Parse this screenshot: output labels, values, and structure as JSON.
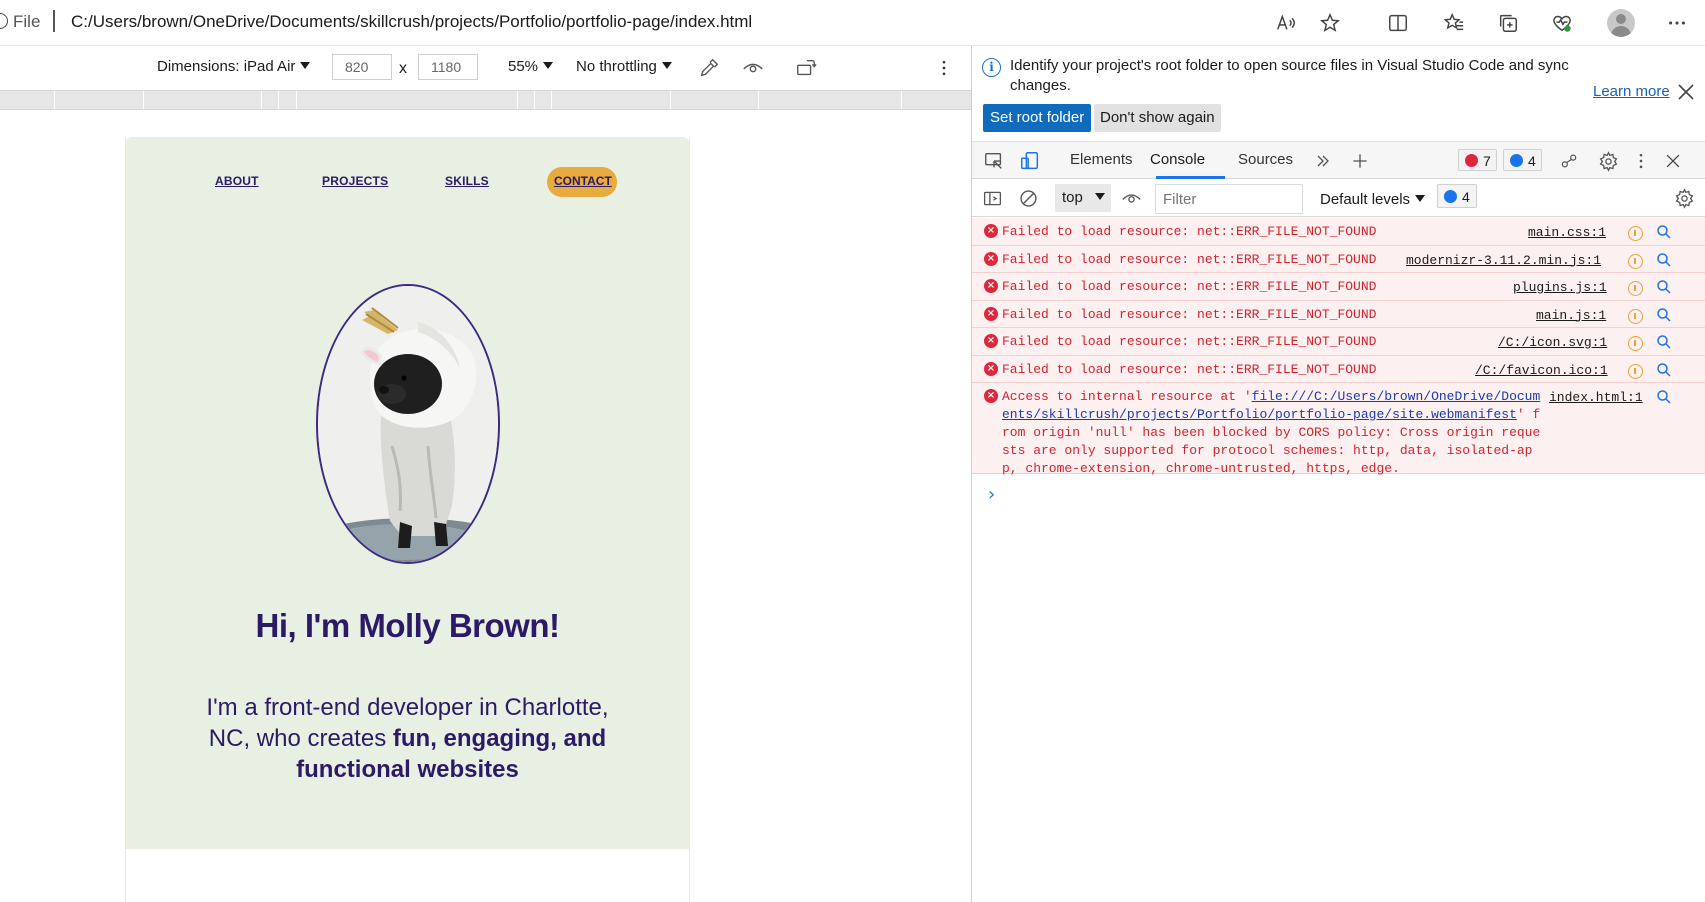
{
  "browser": {
    "scheme_label": "File",
    "url": "C:/Users/brown/OneDrive/Documents/skillcrush/projects/Portfolio/portfolio-page/index.html",
    "icons": [
      "read-aloud-icon",
      "favorite-star-icon",
      "split-screen-icon",
      "favorites-icon",
      "collections-icon",
      "browser-essentials-icon",
      "profile-avatar",
      "more-menu-icon"
    ]
  },
  "device_toolbar": {
    "dimensions_label": "Dimensions: iPad Air",
    "width_value": "820",
    "height_value": "1180",
    "times": "x",
    "zoom": "55%",
    "throttling": "No throttling"
  },
  "site": {
    "nav": [
      "ABOUT",
      "PROJECTS",
      "SKILLS",
      "CONTACT"
    ],
    "title": "Hi, I'm Molly Brown!",
    "text_plain": "I'm a front-end developer in Charlotte, NC, who creates ",
    "text_bold": "fun, engaging, and functional websites",
    "colors": {
      "hero_bg": "#e8efe3",
      "heading": "#2d1a66",
      "contact_pill": "#e8ac3e"
    }
  },
  "devtools": {
    "info": {
      "message": "Identify your project's root folder to open source files in Visual Studio Code and sync changes.",
      "learn_more": "Learn more",
      "primary_button": "Set root folder",
      "secondary_button": "Don't show again"
    },
    "tabs": [
      "Elements",
      "Console",
      "Sources"
    ],
    "active_tab": "Console",
    "error_count": "7",
    "message_count": "4",
    "console_toolbar": {
      "context": "top",
      "filter_placeholder": "Filter",
      "levels": "Default levels",
      "message_count": "4"
    },
    "messages": [
      {
        "text": "Failed to load resource: net::ERR_FILE_NOT_FOUND",
        "source": "main.css:1"
      },
      {
        "text": "Failed to load resource: net::ERR_FILE_NOT_FOUND",
        "source": "modernizr-3.11.2.min.js:1"
      },
      {
        "text": "Failed to load resource: net::ERR_FILE_NOT_FOUND",
        "source": "plugins.js:1"
      },
      {
        "text": "Failed to load resource: net::ERR_FILE_NOT_FOUND",
        "source": "main.js:1"
      },
      {
        "text": "Failed to load resource: net::ERR_FILE_NOT_FOUND",
        "source": "/C:/icon.svg:1"
      },
      {
        "text": "Failed to load resource: net::ERR_FILE_NOT_FOUND",
        "source": "/C:/favicon.ico:1"
      }
    ],
    "cors": {
      "prefix": "Access to internal resource at '",
      "link": "file:///C:/Users/brown/OneDrive/Documents/skillcrush/projects/Portfolio/portfolio-page/site.webmanifest",
      "suffix": "' from origin 'null' has been blocked by CORS policy: Cross origin requests are only supported for protocol schemes: http, data, isolated-app, chrome-extension, chrome-untrusted, https, edge.",
      "source": "index.html:1"
    },
    "colors": {
      "error": "#d4232f",
      "error_bg": "#fdf0f0",
      "accent": "#1a73e8",
      "primary_button": "#0f6cbd"
    }
  }
}
